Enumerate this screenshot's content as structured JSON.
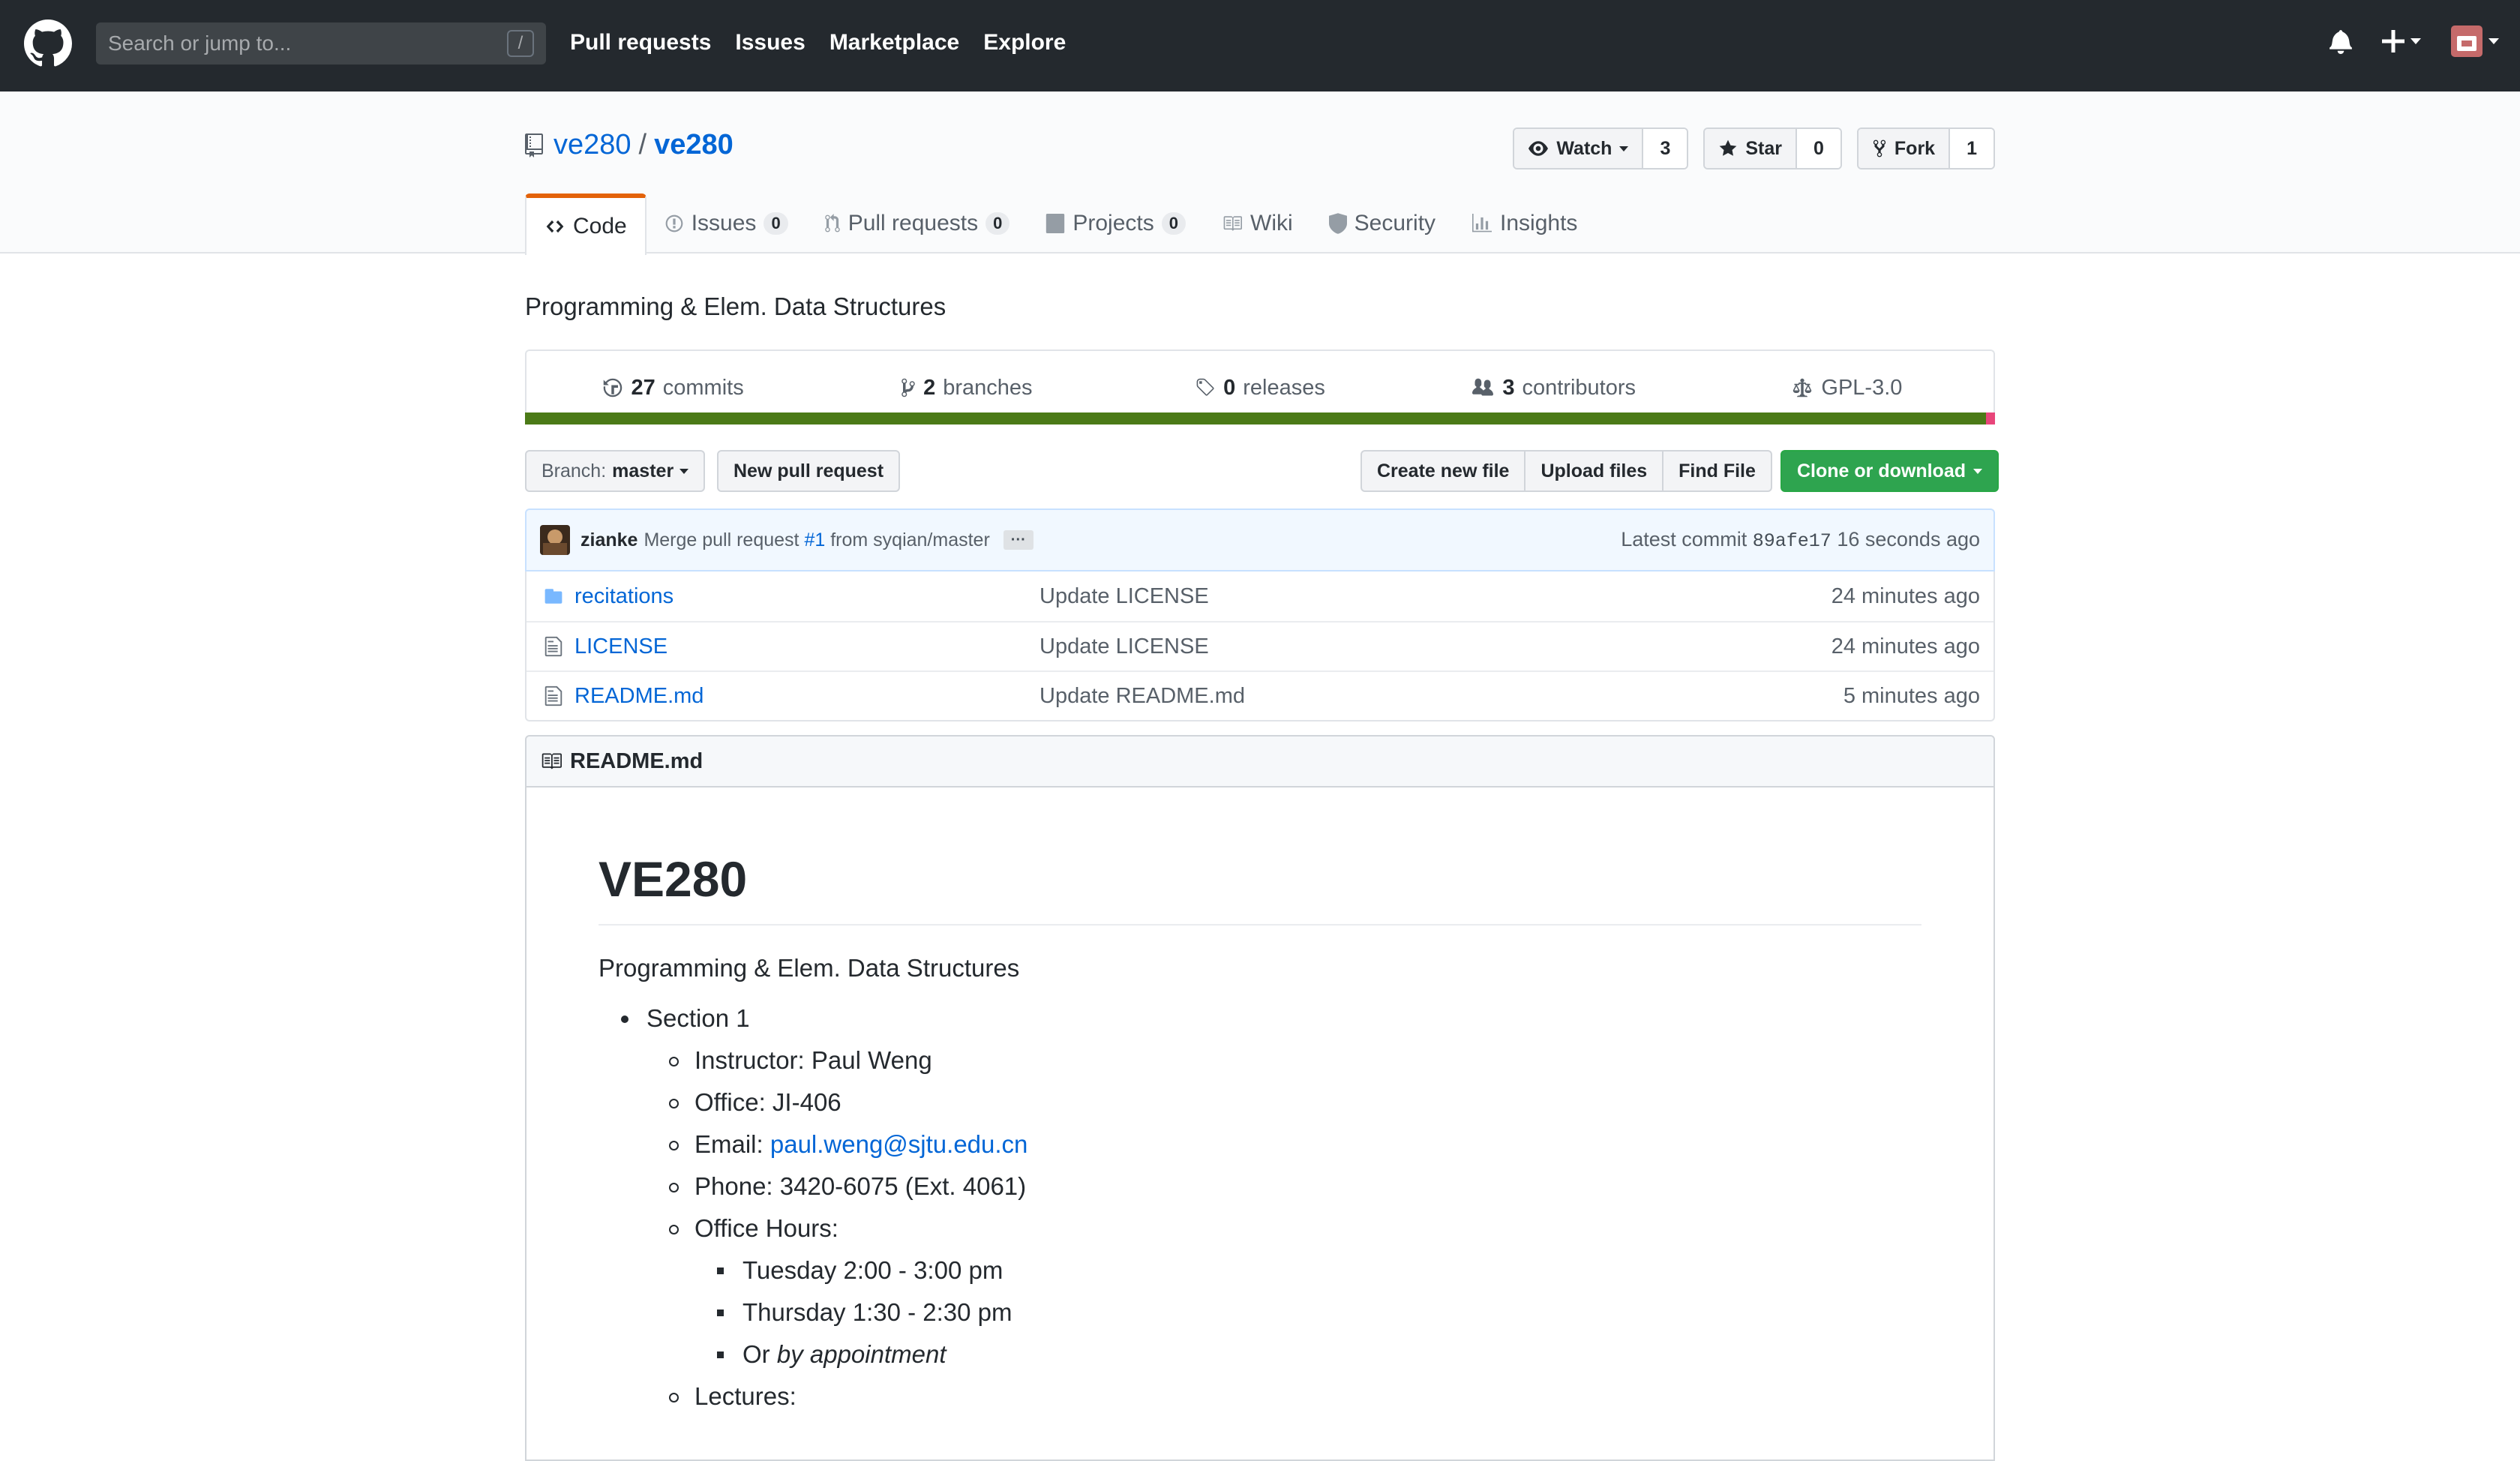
{
  "header": {
    "search_placeholder": "Search or jump to...",
    "search_shortcut": "/",
    "nav": [
      "Pull requests",
      "Issues",
      "Marketplace",
      "Explore"
    ]
  },
  "repo": {
    "owner": "ve280",
    "separator": "/",
    "name": "ve280",
    "watch_label": "Watch",
    "watch_count": "3",
    "star_label": "Star",
    "star_count": "0",
    "fork_label": "Fork",
    "fork_count": "1"
  },
  "tabs": [
    {
      "label": "Code",
      "counter": null
    },
    {
      "label": "Issues",
      "counter": "0"
    },
    {
      "label": "Pull requests",
      "counter": "0"
    },
    {
      "label": "Projects",
      "counter": "0"
    },
    {
      "label": "Wiki",
      "counter": null
    },
    {
      "label": "Security",
      "counter": null
    },
    {
      "label": "Insights",
      "counter": null
    }
  ],
  "description": "Programming & Elem. Data Structures",
  "summary": {
    "commits_num": "27",
    "commits_label": "commits",
    "branches_num": "2",
    "branches_label": "branches",
    "releases_num": "0",
    "releases_label": "releases",
    "contributors_num": "3",
    "contributors_label": "contributors",
    "license": "GPL-3.0"
  },
  "language_colors": [
    "#4b7a17",
    "#e8457a"
  ],
  "toolbar": {
    "branch_prefix": "Branch:",
    "branch_name": "master",
    "new_pr": "New pull request",
    "create_file": "Create new file",
    "upload_files": "Upload files",
    "find_file": "Find File",
    "clone": "Clone or download"
  },
  "commit": {
    "author": "zianke",
    "message_prefix": "Merge pull request",
    "pr_link": "#1",
    "message_suffix": "from syqian/master",
    "ellipsis": "···",
    "latest_label": "Latest commit",
    "sha": "89afe17",
    "age": "16 seconds ago"
  },
  "files": [
    {
      "type": "folder",
      "name": "recitations",
      "message": "Update LICENSE",
      "age": "24 minutes ago"
    },
    {
      "type": "file",
      "name": "LICENSE",
      "message": "Update LICENSE",
      "age": "24 minutes ago"
    },
    {
      "type": "file",
      "name": "README.md",
      "message": "Update README.md",
      "age": "5 minutes ago"
    }
  ],
  "readme": {
    "filename": "README.md",
    "title": "VE280",
    "intro": "Programming & Elem. Data Structures",
    "section": "Section 1",
    "instructor": "Instructor: Paul Weng",
    "office": "Office: JI-406",
    "email_label": "Email:",
    "email": "paul.weng@sjtu.edu.cn",
    "phone": "Phone: 3420-6075 (Ext. 4061)",
    "office_hours": "Office Hours:",
    "oh_1": "Tuesday 2:00 - 3:00 pm",
    "oh_2": "Thursday 1:30 - 2:30 pm",
    "oh_3_prefix": "Or",
    "oh_3_em": "by appointment",
    "lectures": "Lectures:"
  }
}
